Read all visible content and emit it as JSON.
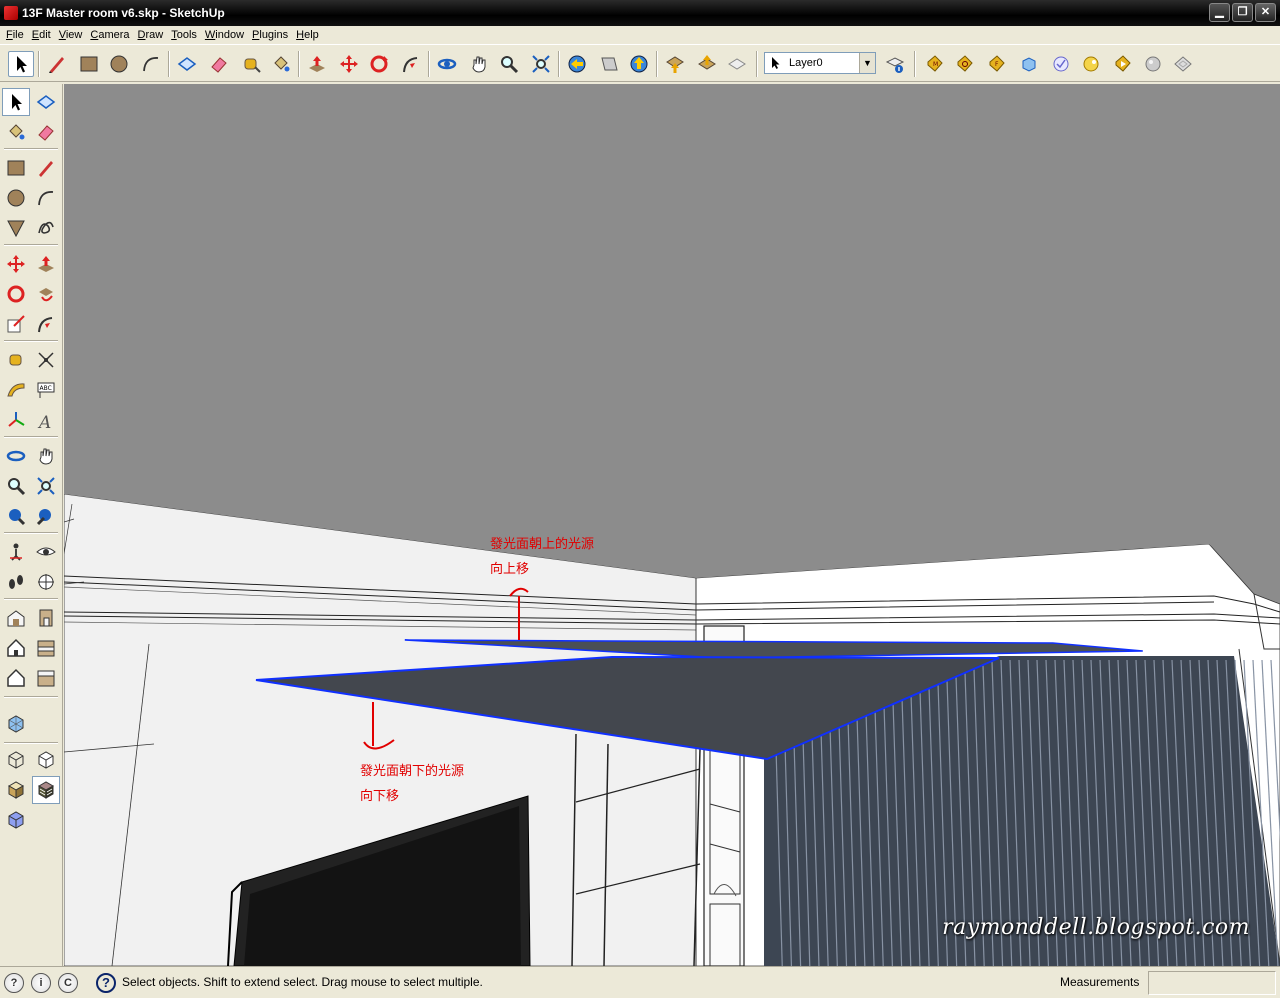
{
  "window": {
    "title": "13F Master room v6.skp - SketchUp"
  },
  "menu": [
    "File",
    "Edit",
    "View",
    "Camera",
    "Draw",
    "Tools",
    "Window",
    "Plugins",
    "Help"
  ],
  "layer": {
    "current": "Layer0"
  },
  "annotations": {
    "upper_line1": "發光面朝上的光源",
    "upper_line2": "向上移",
    "lower_line1": "發光面朝下的光源",
    "lower_line2": "向下移"
  },
  "watermark": "raymonddell.blogspot.com",
  "status": {
    "hint": "Select objects. Shift to extend select. Drag mouse to select multiple.",
    "measurements_label": "Measurements",
    "measurements_value": ""
  },
  "colors": {
    "accent_annotation": "#e10000",
    "selection_edge": "#0000ff",
    "ceiling": "#8c8c8c",
    "panel": "#404449"
  }
}
